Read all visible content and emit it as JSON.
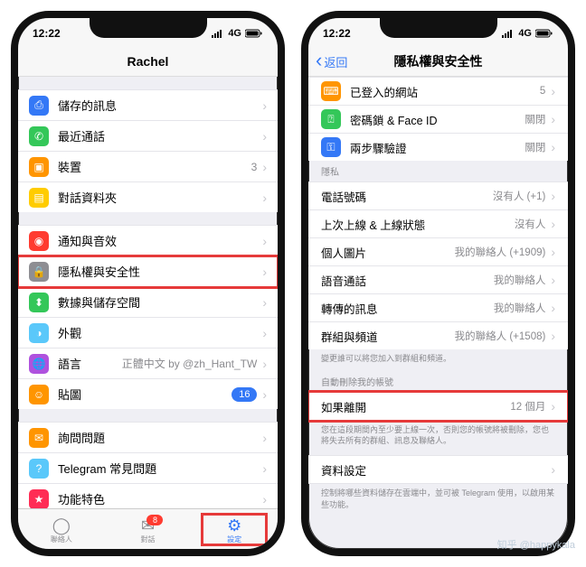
{
  "status": {
    "time": "12:22",
    "network": "4G"
  },
  "left_screen": {
    "title": "Rachel",
    "groups": [
      {
        "rows": [
          {
            "icon_color": "#3478f6",
            "icon_name": "bookmark-icon",
            "glyph": "⎙",
            "label": "儲存的訊息"
          },
          {
            "icon_color": "#34c759",
            "icon_name": "phone-icon",
            "glyph": "✆",
            "label": "最近通話"
          },
          {
            "icon_color": "#ff9500",
            "icon_name": "devices-icon",
            "glyph": "▣",
            "label": "裝置",
            "detail": "3"
          },
          {
            "icon_color": "#ffcc00",
            "icon_name": "folder-icon",
            "glyph": "▤",
            "label": "對話資料夾"
          }
        ]
      },
      {
        "rows": [
          {
            "icon_color": "#ff3b30",
            "icon_name": "bell-icon",
            "glyph": "◉",
            "label": "通知與音效"
          },
          {
            "icon_color": "#8e8e93",
            "icon_name": "lock-icon",
            "glyph": "🔒",
            "label": "隱私權與安全性",
            "highlight": true
          },
          {
            "icon_color": "#34c759",
            "icon_name": "data-icon",
            "glyph": "⬍",
            "label": "數據與儲存空間"
          },
          {
            "icon_color": "#5ac8fa",
            "icon_name": "appearance-icon",
            "glyph": "◑",
            "label": "外觀"
          },
          {
            "icon_color": "#af52de",
            "icon_name": "language-icon",
            "glyph": "🌐",
            "label": "語言",
            "detail": "正體中文 by @zh_Hant_TW"
          },
          {
            "icon_color": "#ff9500",
            "icon_name": "sticker-icon",
            "glyph": "☺",
            "label": "貼圖",
            "badge": "16"
          }
        ]
      },
      {
        "rows": [
          {
            "icon_color": "#ff9500",
            "icon_name": "chat-icon",
            "glyph": "✉",
            "label": "詢問問題"
          },
          {
            "icon_color": "#5ac8fa",
            "icon_name": "faq-icon",
            "glyph": "?",
            "label": "Telegram 常見問題"
          },
          {
            "icon_color": "#ff2d55",
            "icon_name": "features-icon",
            "glyph": "★",
            "label": "功能特色"
          }
        ]
      }
    ],
    "tabs": {
      "contacts": "聯絡人",
      "chats": "對話",
      "chats_badge": "8",
      "settings": "設定"
    }
  },
  "right_screen": {
    "back": "返回",
    "title": "隱私權與安全性",
    "top_rows": [
      {
        "icon_color": "#ff9500",
        "icon_name": "web-icon",
        "glyph": "⌨",
        "label": "已登入的網站",
        "detail": "5"
      },
      {
        "icon_color": "#34c759",
        "icon_name": "faceid-icon",
        "glyph": "⍰",
        "label": "密碼鎖 & Face ID",
        "detail": "關閉"
      },
      {
        "icon_color": "#3478f6",
        "icon_name": "key-icon",
        "glyph": "⚿",
        "label": "兩步驟驗證",
        "detail": "關閉"
      }
    ],
    "privacy_header": "隱私",
    "privacy_rows": [
      {
        "label": "電話號碼",
        "detail": "沒有人 (+1)"
      },
      {
        "label": "上次上線 & 上線狀態",
        "detail": "沒有人"
      },
      {
        "label": "個人圖片",
        "detail": "我的聯絡人 (+1909)"
      },
      {
        "label": "語音通話",
        "detail": "我的聯絡人"
      },
      {
        "label": "轉傳的訊息",
        "detail": "我的聯絡人"
      },
      {
        "label": "群組與頻道",
        "detail": "我的聯絡人 (+1508)"
      }
    ],
    "privacy_footer": "變更誰可以將您加入到群組和頻道。",
    "delete_header": "自動刪除我的帳號",
    "delete_row": {
      "label": "如果離開",
      "detail": "12 個月",
      "highlight": true
    },
    "delete_footer": "您在這段期間內至少要上線一次，否則您的帳號將被刪除，您也將失去所有的群組、訊息及聯絡人。",
    "data_row": {
      "label": "資料設定"
    },
    "data_footer": "控制將哪些資料儲存在雲端中，並可被 Telegram 使用，以啟用某些功能。"
  },
  "watermark": "知乎 @happykala"
}
